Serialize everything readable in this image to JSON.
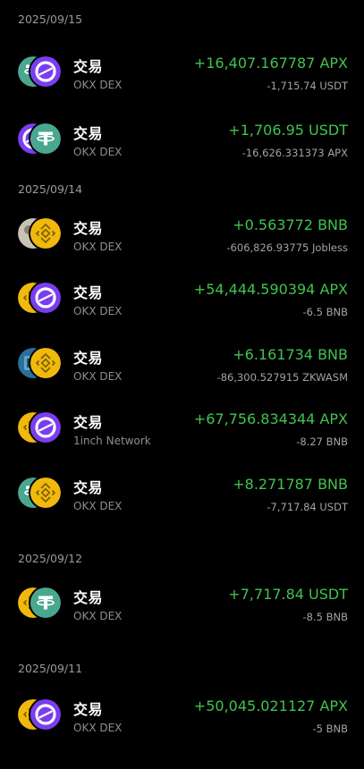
{
  "colors": {
    "positive": "#40c350",
    "muted": "#8e8e8e",
    "background": "#000000"
  },
  "groups": [
    {
      "date": "2025/09/15",
      "items": [
        {
          "title": "交易",
          "source": "OKX DEX",
          "received": "+16,407.167787 APX",
          "sent": "-1,715.74 USDT",
          "icon_back": "usdt-icon",
          "icon_front": "apx-icon"
        },
        {
          "title": "交易",
          "source": "OKX DEX",
          "received": "+1,706.95 USDT",
          "sent": "-16,626.331373 APX",
          "icon_back": "apx-icon",
          "icon_front": "usdt-icon"
        }
      ]
    },
    {
      "date": "2025/09/14",
      "items": [
        {
          "title": "交易",
          "source": "OKX DEX",
          "received": "+0.563772 BNB",
          "sent": "-606,826.93775 Jobless",
          "icon_back": "jobless-icon",
          "icon_front": "bnb-icon"
        },
        {
          "title": "交易",
          "source": "OKX DEX",
          "received": "+54,444.590394 APX",
          "sent": "-6.5 BNB",
          "icon_back": "bnb-icon",
          "icon_front": "apx-icon"
        },
        {
          "title": "交易",
          "source": "OKX DEX",
          "received": "+6.161734 BNB",
          "sent": "-86,300.527915 ZKWASM",
          "icon_back": "zkwasm-icon",
          "icon_front": "bnb-icon"
        },
        {
          "title": "交易",
          "source": "1inch Network",
          "received": "+67,756.834344 APX",
          "sent": "-8.27 BNB",
          "icon_back": "bnb-icon",
          "icon_front": "apx-icon"
        },
        {
          "title": "交易",
          "source": "OKX DEX",
          "received": "+8.271787 BNB",
          "sent": "-7,717.84 USDT",
          "icon_back": "usdt-icon",
          "icon_front": "bnb-icon"
        }
      ]
    },
    {
      "date": "2025/09/12",
      "items": [
        {
          "title": "交易",
          "source": "OKX DEX",
          "received": "+7,717.84 USDT",
          "sent": "-8.5 BNB",
          "icon_back": "bnb-icon",
          "icon_front": "usdt-icon"
        }
      ]
    },
    {
      "date": "2025/09/11",
      "items": [
        {
          "title": "交易",
          "source": "OKX DEX",
          "received": "+50,045.021127 APX",
          "sent": "-5 BNB",
          "icon_back": "bnb-icon",
          "icon_front": "apx-icon"
        }
      ]
    }
  ]
}
